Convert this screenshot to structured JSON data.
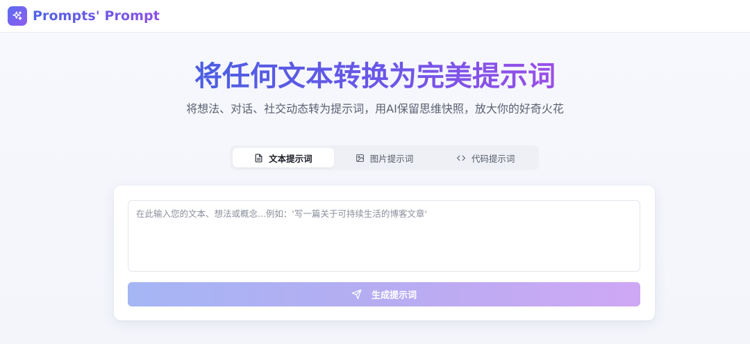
{
  "header": {
    "brand": "Prompts' Prompt",
    "logo_icon": "sparkles-icon"
  },
  "hero": {
    "title": "将任何文本转换为完美提示词",
    "subtitle": "将想法、对话、社交动态转为提示词，用AI保留思维快照，放大你的好奇火花"
  },
  "tabs": [
    {
      "label": "文本提示词",
      "icon": "document-icon",
      "active": true
    },
    {
      "label": "图片提示词",
      "icon": "image-icon",
      "active": false
    },
    {
      "label": "代码提示词",
      "icon": "code-icon",
      "active": false
    }
  ],
  "input": {
    "value": "",
    "placeholder": "在此输入您的文本、想法或概念...例如：'写一篇关于可持续生活的博客文章'"
  },
  "generate_button": {
    "label": "生成提示词",
    "icon": "send-icon"
  },
  "colors": {
    "brand_start": "#4f63e6",
    "brand_end": "#8b4fe6",
    "button_start": "#a5b6f5",
    "button_end": "#cfa8f4"
  }
}
